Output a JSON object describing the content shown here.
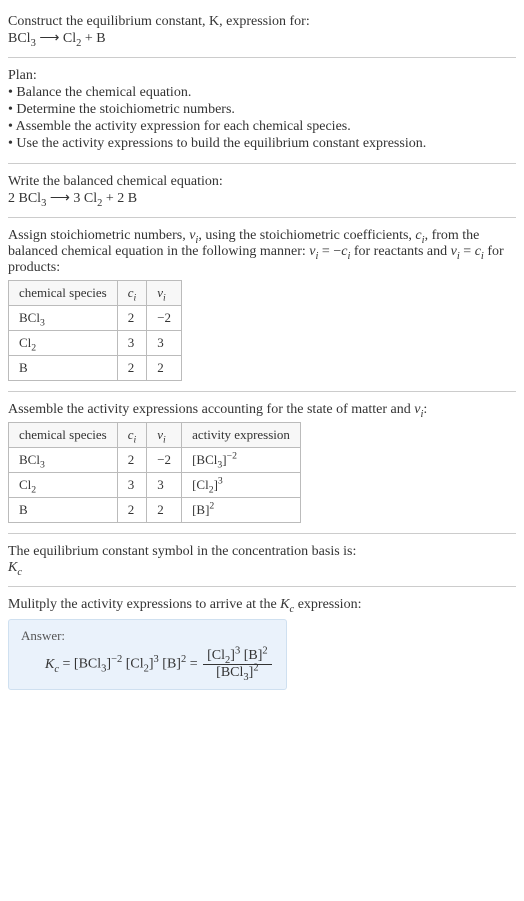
{
  "intro": {
    "line1": "Construct the equilibrium constant, K, expression for:",
    "eq": "BCl₃ ⟶ Cl₂ + B"
  },
  "plan": {
    "heading": "Plan:",
    "items": [
      "• Balance the chemical equation.",
      "• Determine the stoichiometric numbers.",
      "• Assemble the activity expression for each chemical species.",
      "• Use the activity expressions to build the equilibrium constant expression."
    ]
  },
  "balanced": {
    "heading": "Write the balanced chemical equation:",
    "eq": "2 BCl₃ ⟶ 3 Cl₂ + 2 B"
  },
  "stoich": {
    "heading_a": "Assign stoichiometric numbers, νᵢ, using the stoichiometric coefficients, cᵢ, from the balanced chemical equation in the following manner: νᵢ = −cᵢ for reactants and νᵢ = cᵢ for products:",
    "cols": [
      "chemical species",
      "cᵢ",
      "νᵢ"
    ],
    "rows": [
      {
        "species": "BCl₃",
        "c": "2",
        "v": "−2"
      },
      {
        "species": "Cl₂",
        "c": "3",
        "v": "3"
      },
      {
        "species": "B",
        "c": "2",
        "v": "2"
      }
    ]
  },
  "activity": {
    "heading": "Assemble the activity expressions accounting for the state of matter and νᵢ:",
    "cols": [
      "chemical species",
      "cᵢ",
      "νᵢ",
      "activity expression"
    ],
    "rows": [
      {
        "species": "BCl₃",
        "c": "2",
        "v": "−2",
        "expr_html": "[BCl<sub>3</sub>]<sup>−2</sup>"
      },
      {
        "species": "Cl₂",
        "c": "3",
        "v": "3",
        "expr_html": "[Cl<sub>2</sub>]<sup>3</sup>"
      },
      {
        "species": "B",
        "c": "2",
        "v": "2",
        "expr_html": "[B]<sup>2</sup>"
      }
    ]
  },
  "kc_symbol": {
    "heading": "The equilibrium constant symbol in the concentration basis is:",
    "sym": "K_c"
  },
  "multiply": {
    "heading": "Mulitply the activity expressions to arrive at the Kc expression:"
  },
  "answer": {
    "label": "Answer:",
    "lhs": "K_c = ",
    "flat": "[BCl₃]⁻² [Cl₂]³ [B]²",
    "eq": " = ",
    "num": "[Cl₂]³ [B]²",
    "den": "[BCl₃]²"
  }
}
